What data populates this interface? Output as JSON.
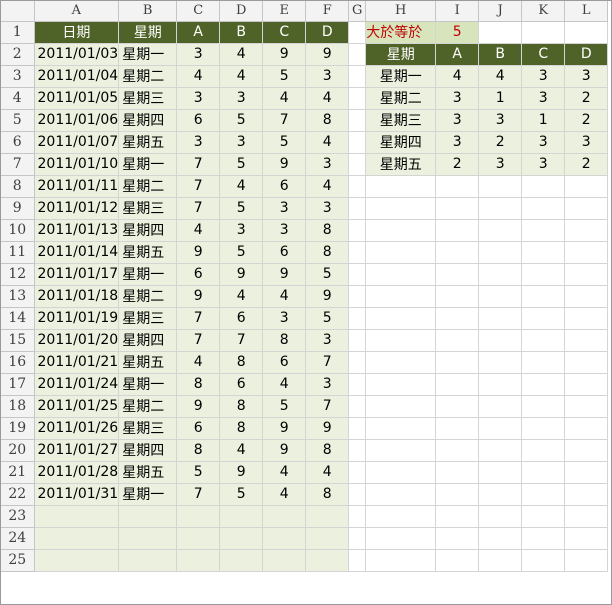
{
  "spreadsheet": {
    "columns": [
      "A",
      "B",
      "C",
      "D",
      "E",
      "F",
      "G",
      "H",
      "I",
      "J",
      "K",
      "L"
    ],
    "rows": [
      "1",
      "2",
      "3",
      "4",
      "5",
      "6",
      "7",
      "8",
      "9",
      "10",
      "11",
      "12",
      "13",
      "14",
      "15",
      "16",
      "17",
      "18",
      "19",
      "20",
      "21",
      "22",
      "23",
      "24",
      "25"
    ],
    "left_table": {
      "headers": [
        "日期",
        "星期",
        "A",
        "B",
        "C",
        "D"
      ],
      "records": [
        [
          "2011/01/03",
          "星期一",
          "3",
          "4",
          "9",
          "9"
        ],
        [
          "2011/01/04",
          "星期二",
          "4",
          "4",
          "5",
          "3"
        ],
        [
          "2011/01/05",
          "星期三",
          "3",
          "3",
          "4",
          "4"
        ],
        [
          "2011/01/06",
          "星期四",
          "6",
          "5",
          "7",
          "8"
        ],
        [
          "2011/01/07",
          "星期五",
          "3",
          "3",
          "5",
          "4"
        ],
        [
          "2011/01/10",
          "星期一",
          "7",
          "5",
          "9",
          "3"
        ],
        [
          "2011/01/11",
          "星期二",
          "7",
          "4",
          "6",
          "4"
        ],
        [
          "2011/01/12",
          "星期三",
          "7",
          "5",
          "3",
          "3"
        ],
        [
          "2011/01/13",
          "星期四",
          "4",
          "3",
          "3",
          "8"
        ],
        [
          "2011/01/14",
          "星期五",
          "9",
          "5",
          "6",
          "8"
        ],
        [
          "2011/01/17",
          "星期一",
          "6",
          "9",
          "9",
          "5"
        ],
        [
          "2011/01/18",
          "星期二",
          "9",
          "4",
          "4",
          "9"
        ],
        [
          "2011/01/19",
          "星期三",
          "7",
          "6",
          "3",
          "5"
        ],
        [
          "2011/01/20",
          "星期四",
          "7",
          "7",
          "8",
          "3"
        ],
        [
          "2011/01/21",
          "星期五",
          "4",
          "8",
          "6",
          "7"
        ],
        [
          "2011/01/24",
          "星期一",
          "8",
          "6",
          "4",
          "3"
        ],
        [
          "2011/01/25",
          "星期二",
          "9",
          "8",
          "5",
          "7"
        ],
        [
          "2011/01/26",
          "星期三",
          "6",
          "8",
          "9",
          "9"
        ],
        [
          "2011/01/27",
          "星期四",
          "8",
          "4",
          "9",
          "8"
        ],
        [
          "2011/01/28",
          "星期五",
          "5",
          "9",
          "4",
          "4"
        ],
        [
          "2011/01/31",
          "星期一",
          "7",
          "5",
          "4",
          "8"
        ]
      ]
    },
    "criteria": {
      "label": "大於等於",
      "value": "5"
    },
    "summary_table": {
      "headers": [
        "星期",
        "A",
        "B",
        "C",
        "D"
      ],
      "records": [
        [
          "星期一",
          "4",
          "4",
          "3",
          "3"
        ],
        [
          "星期二",
          "3",
          "1",
          "3",
          "2"
        ],
        [
          "星期三",
          "3",
          "3",
          "1",
          "2"
        ],
        [
          "星期四",
          "3",
          "2",
          "3",
          "3"
        ],
        [
          "星期五",
          "2",
          "3",
          "3",
          "2"
        ]
      ]
    },
    "colors": {
      "header_fill": "#4f6228",
      "data_fill": "#ebf1de",
      "criteria_fill": "#d7e4bc",
      "criteria_text": "#c00000"
    }
  }
}
